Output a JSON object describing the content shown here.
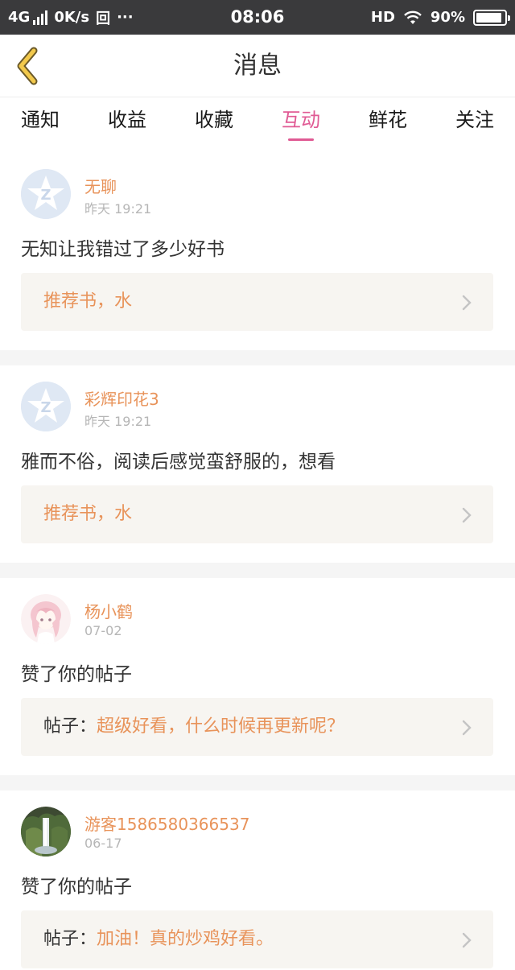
{
  "status_bar": {
    "network": "4G",
    "speed": "0K/s",
    "icon_extra": "回",
    "dots": "···",
    "time": "08:06",
    "hd": "HD",
    "battery": "90%",
    "battery_level": 0.9
  },
  "header": {
    "title": "消息"
  },
  "tabs": [
    {
      "label": "通知",
      "active": false
    },
    {
      "label": "收益",
      "active": false
    },
    {
      "label": "收藏",
      "active": false
    },
    {
      "label": "互动",
      "active": true
    },
    {
      "label": "鲜花",
      "active": false
    },
    {
      "label": "关注",
      "active": false
    }
  ],
  "messages": [
    {
      "username": "无聊",
      "time": "昨天 19:21",
      "content": "无知让我错过了多少好书",
      "ref_prefix": "",
      "ref_text": "推荐书，水",
      "avatar": "default-q-icon"
    },
    {
      "username": "彩辉印花3",
      "time": "昨天 19:21",
      "content": "雅而不俗，阅读后感觉蛮舒服的，想看",
      "ref_prefix": "",
      "ref_text": "推荐书，水",
      "avatar": "default-q-icon"
    },
    {
      "username": "杨小鹤",
      "time": "07-02",
      "content": "赞了你的帖子",
      "ref_prefix": "帖子：",
      "ref_text": "超级好看，什么时候再更新呢？",
      "avatar": "anime-girl-avatar"
    },
    {
      "username": "游客1586580366537",
      "time": "06-17",
      "content": "赞了你的帖子",
      "ref_prefix": "帖子：",
      "ref_text": "加油！真的炒鸡好看。",
      "avatar": "waterfall-avatar"
    }
  ],
  "colors": {
    "accent": "#e05a94",
    "username": "#e8935a",
    "back_arrow": "#f2c94c"
  }
}
